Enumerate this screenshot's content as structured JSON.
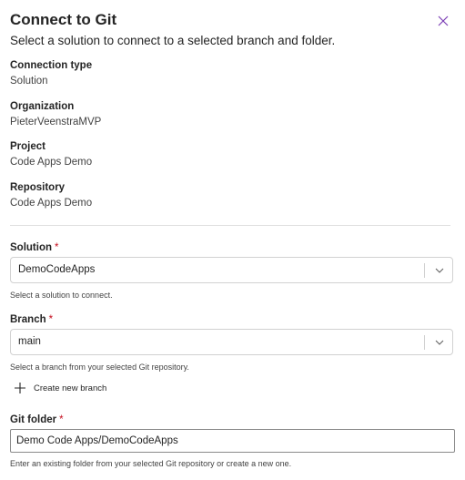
{
  "dialog": {
    "title": "Connect to Git",
    "subtitle": "Select a solution to connect to a selected branch and folder.",
    "close_icon": "close-icon"
  },
  "info": [
    {
      "label": "Connection type",
      "value": "Solution"
    },
    {
      "label": "Organization",
      "value": "PieterVeenstraMVP"
    },
    {
      "label": "Project",
      "value": "Code Apps Demo"
    },
    {
      "label": "Repository",
      "value": "Code Apps Demo"
    }
  ],
  "solution": {
    "label": "Solution",
    "required_marker": "*",
    "value": "DemoCodeApps",
    "help": "Select a solution to connect."
  },
  "branch": {
    "label": "Branch",
    "required_marker": "*",
    "value": "main",
    "help": "Select a branch from your selected Git repository.",
    "create_label": "Create new branch"
  },
  "git_folder": {
    "label": "Git folder",
    "required_marker": "*",
    "value": "Demo Code Apps/DemoCodeApps",
    "help": "Enter an existing folder from your selected Git repository or create a new one."
  },
  "colors": {
    "accent": "#8a3ffc",
    "required": "#c50f1f",
    "border": "#d1d1d1"
  }
}
